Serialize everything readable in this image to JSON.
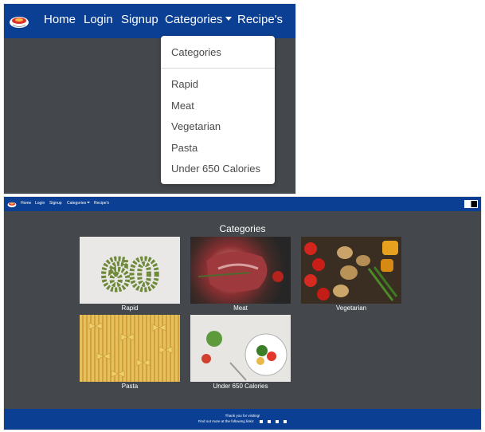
{
  "zoom_view": {
    "nav": {
      "home": "Home",
      "login": "Login",
      "signup": "Signup",
      "categories": "Categories",
      "recipes": "Recipe's"
    },
    "dropdown": {
      "header": "Categories",
      "items": [
        "Rapid",
        "Meat",
        "Vegetarian",
        "Pasta",
        "Under 650 Calories"
      ]
    }
  },
  "full_view": {
    "nav": {
      "home": "Home",
      "login": "Login",
      "signup": "Signup",
      "categories": "Categories",
      "recipes": "Recipe's"
    },
    "page_title": "Categories",
    "cards": [
      {
        "label": "Rapid",
        "image_text": "60"
      },
      {
        "label": "Meat"
      },
      {
        "label": "Vegetarian"
      },
      {
        "label": "Pasta"
      },
      {
        "label": "Under 650 Calories"
      }
    ],
    "footer": {
      "thanks": "Thank you for visiting!",
      "find_more": "Find out more at the following links:",
      "social_icons": [
        "facebook-icon",
        "twitter-icon",
        "instagram-icon",
        "youtube-icon"
      ]
    }
  },
  "colors": {
    "navbar": "#0b3f93",
    "background": "#44484c",
    "text": "#ffffff"
  }
}
